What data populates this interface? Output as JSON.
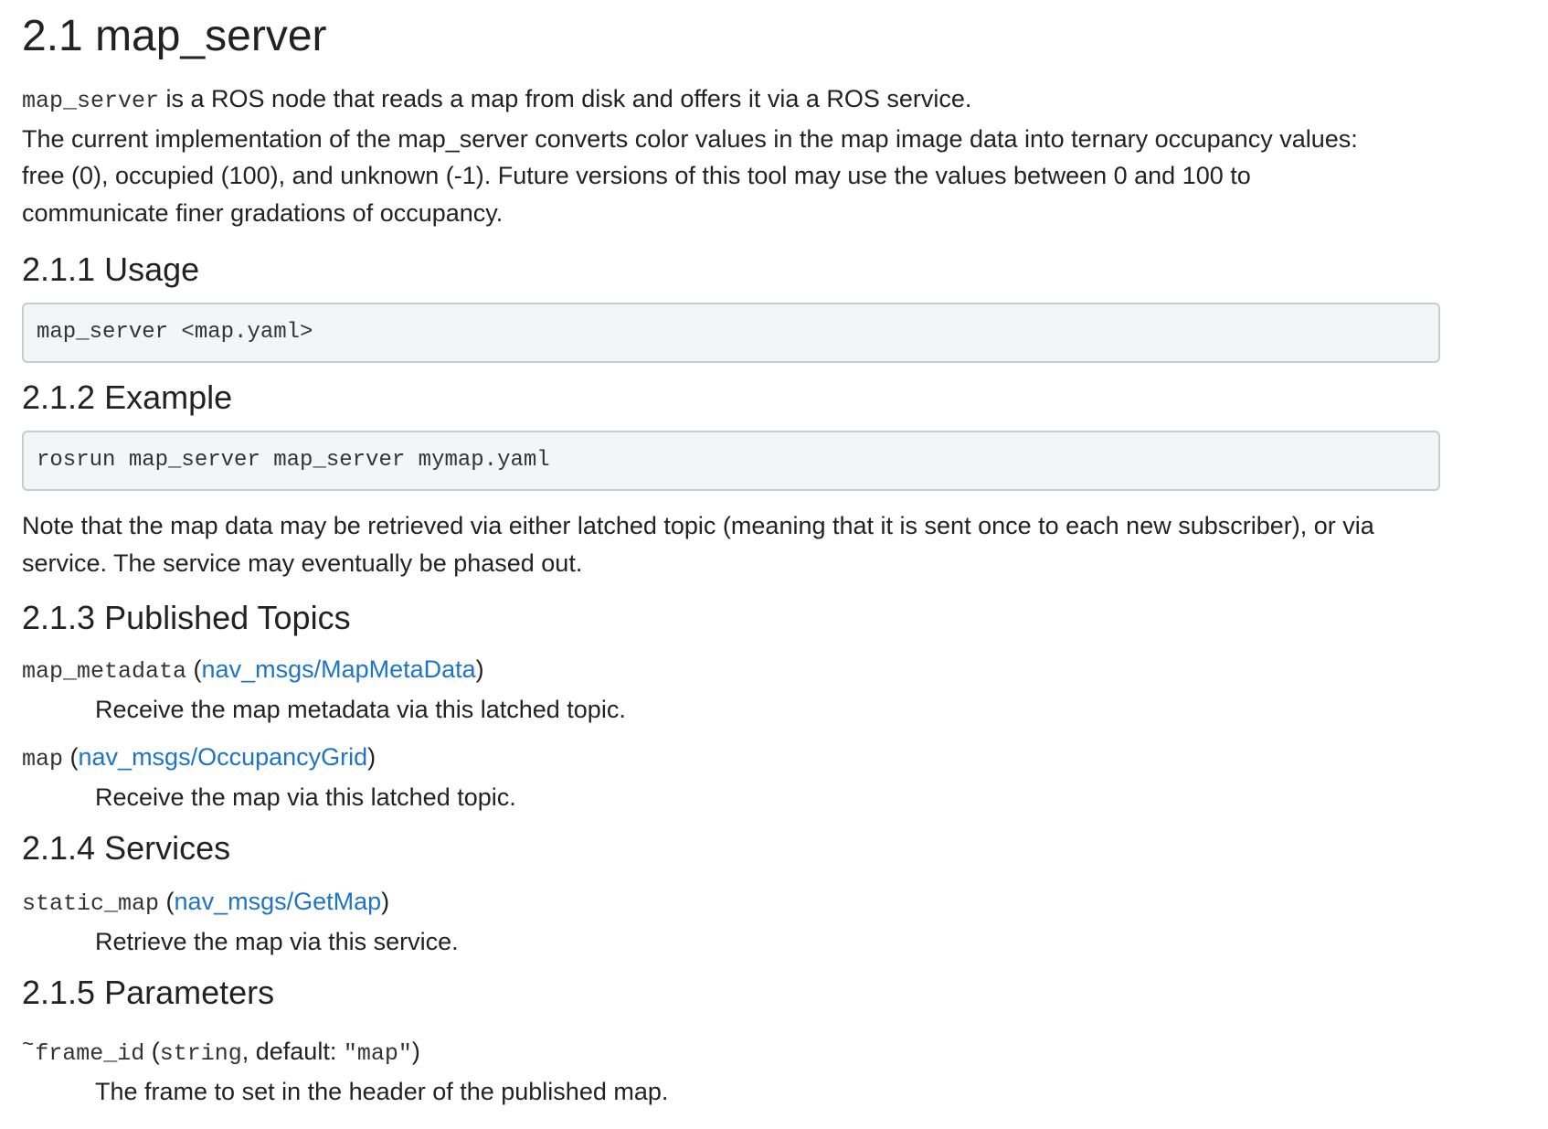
{
  "title": "2.1 map_server",
  "intro": {
    "code": "map_server",
    "text1": " is a ROS node that reads a map from disk and offers it via a ROS service.",
    "line2": "The current implementation of the map_server converts color values in the map image data into ternary occupancy values:",
    "line3": "free (0), occupied (100), and unknown (-1). Future versions of this tool may use the values between 0 and 100 to",
    "line4": "communicate finer gradations of occupancy."
  },
  "usage": {
    "heading": "2.1.1 Usage",
    "code": "map_server <map.yaml>"
  },
  "example": {
    "heading": "2.1.2 Example",
    "code": "rosrun map_server map_server mymap.yaml"
  },
  "note": {
    "line1": "Note that the map data may be retrieved via either latched topic (meaning that it is sent once to each new subscriber), or via",
    "line2": "service. The service may eventually be phased out."
  },
  "published_topics": {
    "heading": "2.1.3 Published Topics",
    "items": [
      {
        "name": "map_metadata",
        "type": "nav_msgs/MapMetaData",
        "desc": "Receive the map metadata via this latched topic."
      },
      {
        "name": "map",
        "type": "nav_msgs/OccupancyGrid",
        "desc": "Receive the map via this latched topic."
      }
    ]
  },
  "services": {
    "heading": "2.1.4 Services",
    "items": [
      {
        "name": "static_map",
        "type": "nav_msgs/GetMap",
        "desc": "Retrieve the map via this service."
      }
    ]
  },
  "parameters": {
    "heading": "2.1.5 Parameters",
    "items": [
      {
        "tilde": "~",
        "name": "frame_id",
        "type": "string",
        "default_label": ", default: ",
        "open_quote": "″",
        "default_value": "map",
        "close_quote": "″",
        "desc": "The frame to set in the header of the published map."
      }
    ]
  },
  "punct": {
    "open_paren": " (",
    "close_paren": ")"
  }
}
